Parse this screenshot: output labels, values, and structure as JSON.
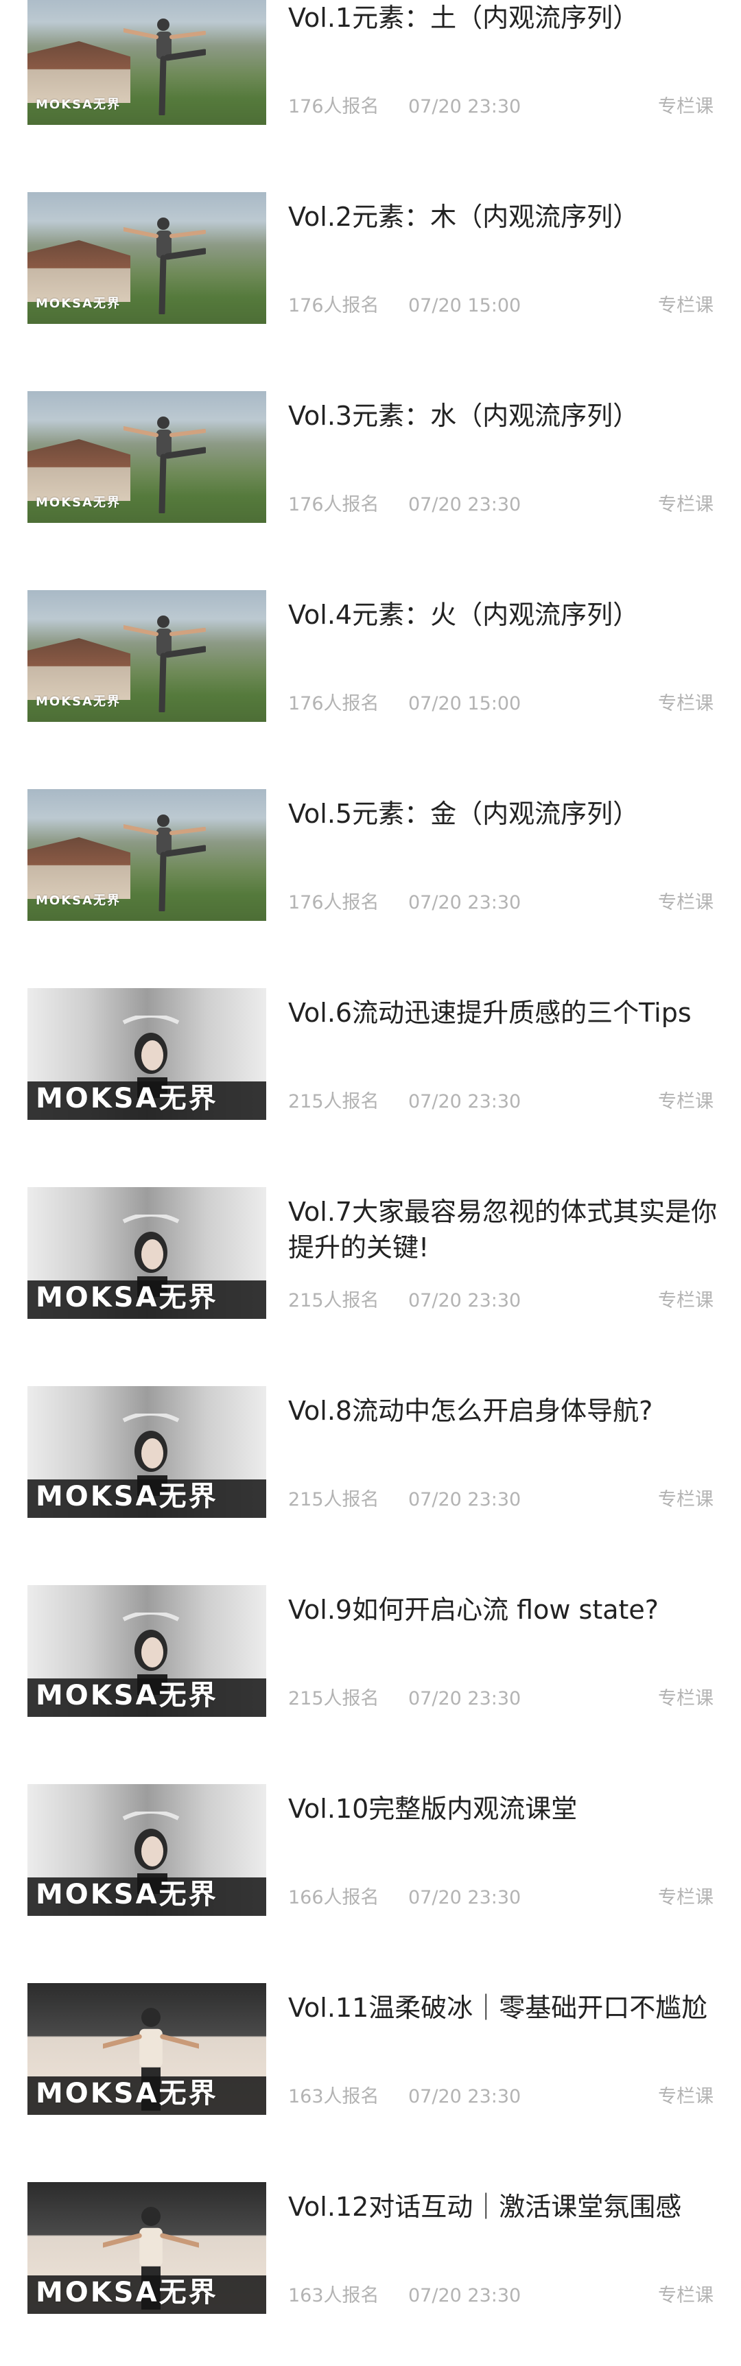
{
  "items": [
    {
      "title": "Vol.1元素：土（内观流序列）",
      "signups": "176人报名",
      "time": "07/20 23:30",
      "tag": "专栏课",
      "thumb": "scenic"
    },
    {
      "title": "Vol.2元素：木（内观流序列）",
      "signups": "176人报名",
      "time": "07/20 15:00",
      "tag": "专栏课",
      "thumb": "scenic"
    },
    {
      "title": "Vol.3元素：水（内观流序列）",
      "signups": "176人报名",
      "time": "07/20 23:30",
      "tag": "专栏课",
      "thumb": "scenic"
    },
    {
      "title": "Vol.4元素：火（内观流序列）",
      "signups": "176人报名",
      "time": "07/20 15:00",
      "tag": "专栏课",
      "thumb": "scenic"
    },
    {
      "title": "Vol.5元素：金（内观流序列）",
      "signups": "176人报名",
      "time": "07/20 23:30",
      "tag": "专栏课",
      "thumb": "scenic"
    },
    {
      "title": "Vol.6流动迅速提升质感的三个Tips",
      "signups": "215人报名",
      "time": "07/20 23:30",
      "tag": "专栏课",
      "thumb": "studio"
    },
    {
      "title": "Vol.7大家最容易忽视的体式其实是你提升的关键!",
      "signups": "215人报名",
      "time": "07/20 23:30",
      "tag": "专栏课",
      "thumb": "studio"
    },
    {
      "title": "Vol.8流动中怎么开启身体导航?",
      "signups": "215人报名",
      "time": "07/20 23:30",
      "tag": "专栏课",
      "thumb": "studio"
    },
    {
      "title": "Vol.9如何开启心流 flow state?",
      "signups": "215人报名",
      "time": "07/20 23:30",
      "tag": "专栏课",
      "thumb": "studio"
    },
    {
      "title": "Vol.10完整版内观流课堂",
      "signups": "166人报名",
      "time": "07/20 23:30",
      "tag": "专栏课",
      "thumb": "studio"
    },
    {
      "title": "Vol.11温柔破冰｜零基础开口不尴尬",
      "signups": "163人报名",
      "time": "07/20 23:30",
      "tag": "专栏课",
      "thumb": "warm"
    },
    {
      "title": "Vol.12对话互动｜激活课堂氛围感",
      "signups": "163人报名",
      "time": "07/20 23:30",
      "tag": "专栏课",
      "thumb": "warm"
    }
  ],
  "logo_scenic": "MOKSA无界",
  "logo_big": "MOKSA无界",
  "icons": {
    "thumb_scenic": "yoga-pose-outdoor-image",
    "thumb_studio": "yoga-portrait-image",
    "thumb_warm": "yoga-class-image"
  }
}
